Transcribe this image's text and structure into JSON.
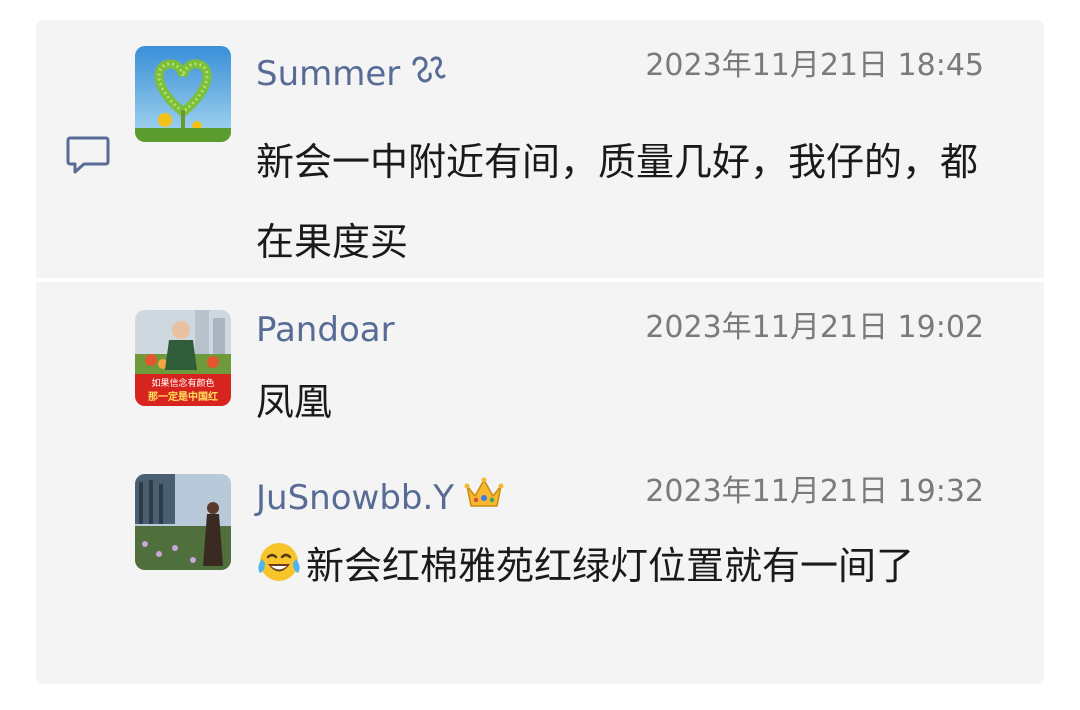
{
  "comments": [
    {
      "user": "Summer",
      "time": "2023年11月21日 18:45",
      "text": "新会一中附近有间，质量几好，我仔的，都在果度买",
      "icon": "comment-icon"
    },
    {
      "user": "Pandoar",
      "time": "2023年11月21日 19:02",
      "text": "凤凰",
      "avatar_banner_line1": "如果信念有颜色",
      "avatar_banner_line2": "那一定是中国红"
    },
    {
      "user": "JuSnowbb.Y",
      "time": "2023年11月21日 19:32",
      "text": "新会红棉雅苑红绿灯位置就有一间了",
      "user_badge": "crown-emoji",
      "text_prefix_emoji": "laughing-tears-emoji"
    }
  ],
  "colors": {
    "name": "#576b95",
    "time": "#7a7a7a",
    "text": "#1a1a1a",
    "card_bg": "#f4f4f5"
  }
}
